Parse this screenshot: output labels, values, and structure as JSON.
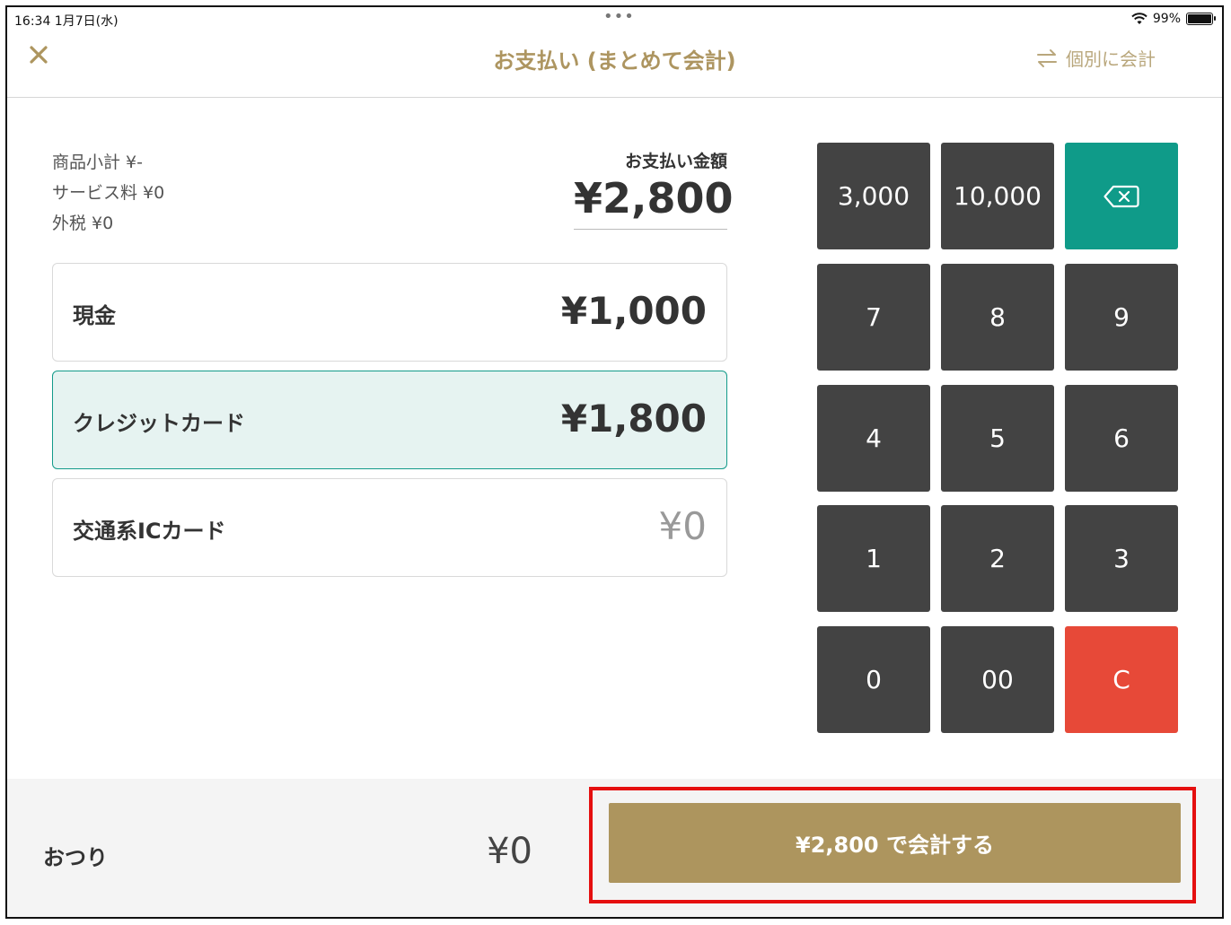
{
  "status_bar": {
    "time": "16:34  1月7日(水)",
    "dots": "•••",
    "battery": "99%"
  },
  "header": {
    "title": "お支払い (まとめて会計)",
    "split_label": "個別に会計"
  },
  "summary": {
    "subtotal": "商品小計 ¥-",
    "service_fee": "サービス料 ¥0",
    "tax": "外税 ¥0"
  },
  "payment": {
    "label": "お支払い金額",
    "amount": "¥2,800"
  },
  "methods": [
    {
      "label": "現金",
      "amount": "¥1,000"
    },
    {
      "label": "クレジットカード",
      "amount": "¥1,800"
    },
    {
      "label": "交通系ICカード",
      "amount": "¥0"
    }
  ],
  "keypad": {
    "k3000": "3,000",
    "k10000": "10,000",
    "k7": "7",
    "k8": "8",
    "k9": "9",
    "k4": "4",
    "k5": "5",
    "k6": "6",
    "k1": "1",
    "k2": "2",
    "k3": "3",
    "k0": "0",
    "k00": "00",
    "kc": "C"
  },
  "footer": {
    "change_label": "おつり",
    "change_value": "¥0",
    "checkout_label": "¥2,800 で会計する"
  },
  "colors": {
    "accent_gold": "#ad955e",
    "teal": "#0f9b89",
    "red": "#e74938",
    "key_dark": "#434343"
  }
}
